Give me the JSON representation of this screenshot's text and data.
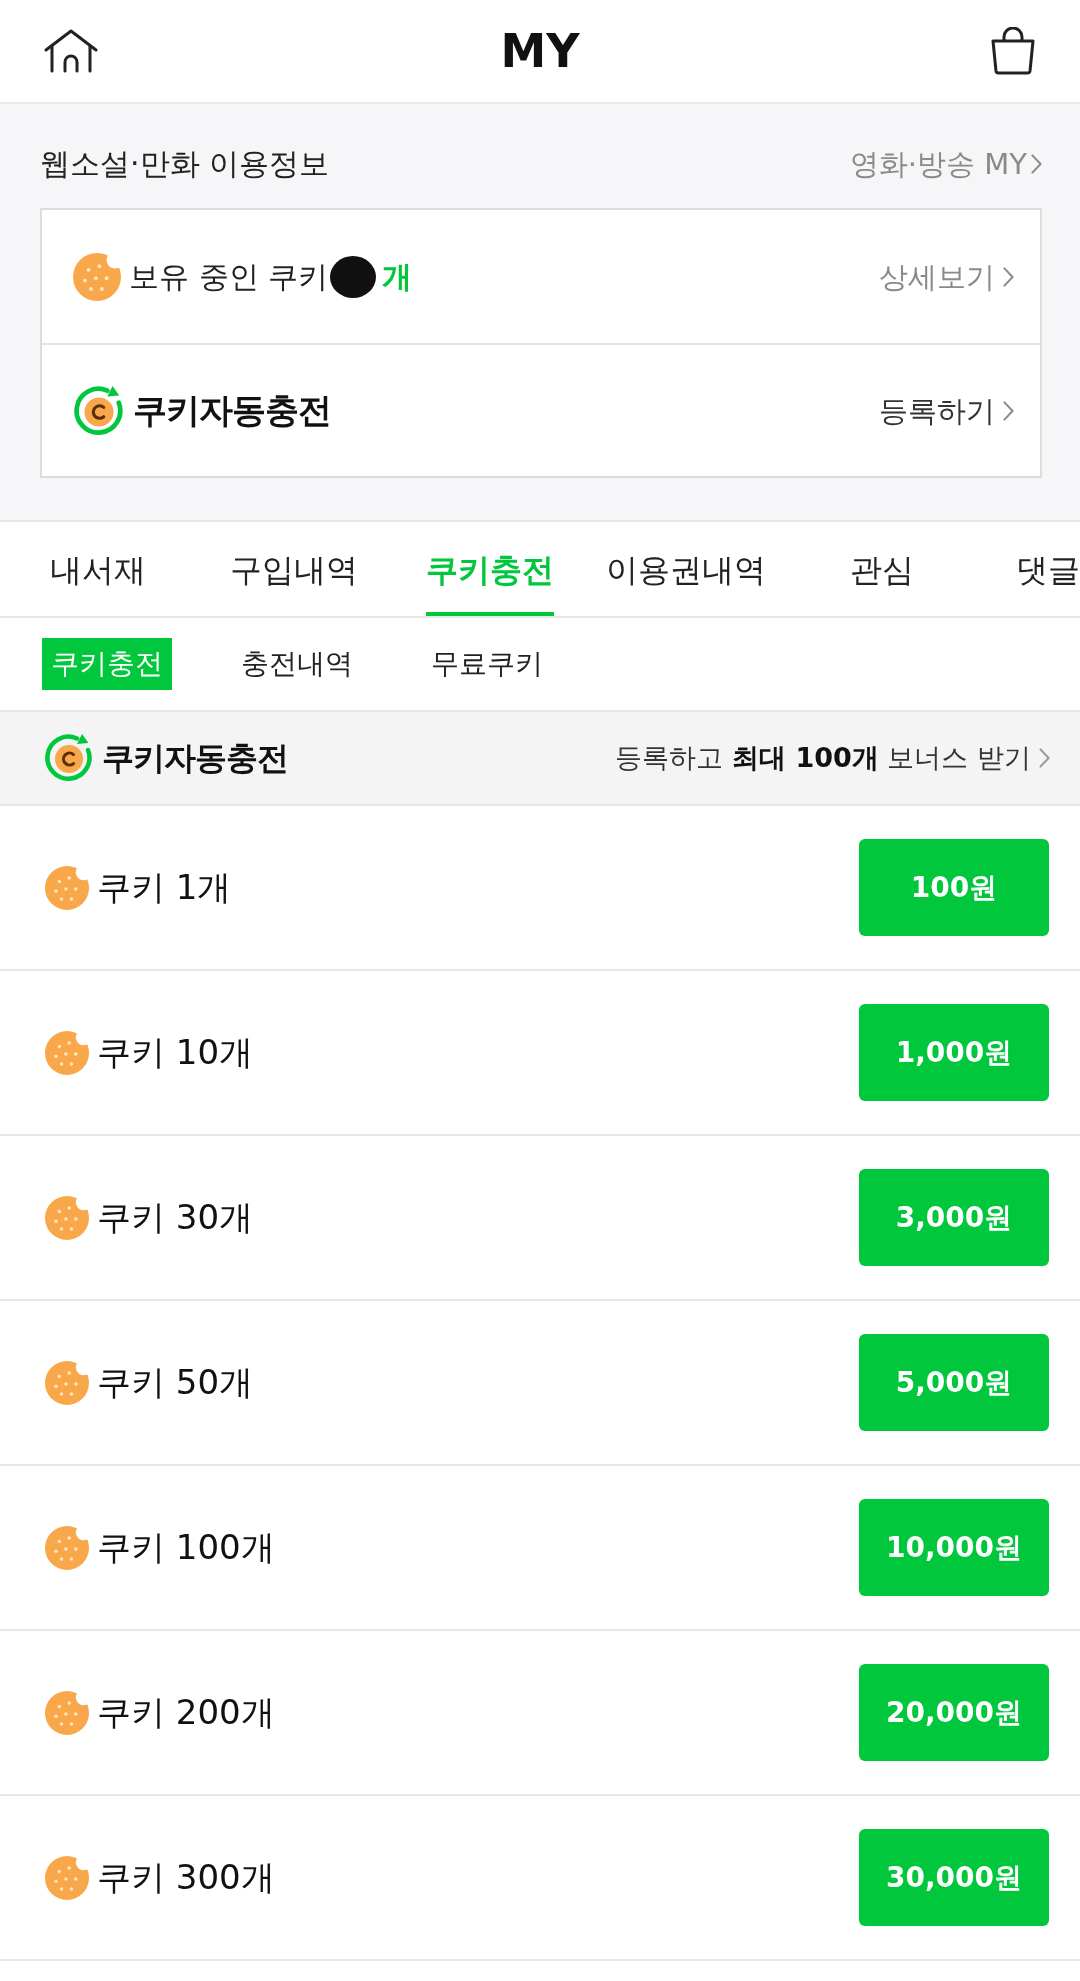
{
  "header": {
    "title": "MY"
  },
  "usage_info": {
    "title": "웹소설·만화 이용정보",
    "link": "영화·방송 MY",
    "cookie_balance": {
      "label": "보유 중인 쿠키",
      "count_hidden": true,
      "unit": "개",
      "link": "상세보기"
    },
    "auto_charge": {
      "title": "쿠키자동충전",
      "link": "등록하기"
    }
  },
  "tabs": [
    {
      "label": "내서재",
      "selected": false
    },
    {
      "label": "구입내역",
      "selected": false
    },
    {
      "label": "쿠키충전",
      "selected": true
    },
    {
      "label": "이용권내역",
      "selected": false
    },
    {
      "label": "관심",
      "selected": false
    },
    {
      "label": "댓글",
      "selected": false
    }
  ],
  "sub_tabs": [
    {
      "label": "쿠키충전",
      "selected": true
    },
    {
      "label": "충전내역",
      "selected": false
    },
    {
      "label": "무료쿠키",
      "selected": false
    }
  ],
  "auto_charge_banner": {
    "title": "쿠키자동충전",
    "text": "등록하고 **최대 100개** 보너스 받기"
  },
  "products": [
    {
      "name": "쿠키 1개",
      "price": "100원"
    },
    {
      "name": "쿠키 10개",
      "price": "1,000원"
    },
    {
      "name": "쿠키 30개",
      "price": "3,000원"
    },
    {
      "name": "쿠키 50개",
      "price": "5,000원"
    },
    {
      "name": "쿠키 100개",
      "price": "10,000원"
    },
    {
      "name": "쿠키 200개",
      "price": "20,000원"
    },
    {
      "name": "쿠키 300개",
      "price": "30,000원"
    }
  ]
}
